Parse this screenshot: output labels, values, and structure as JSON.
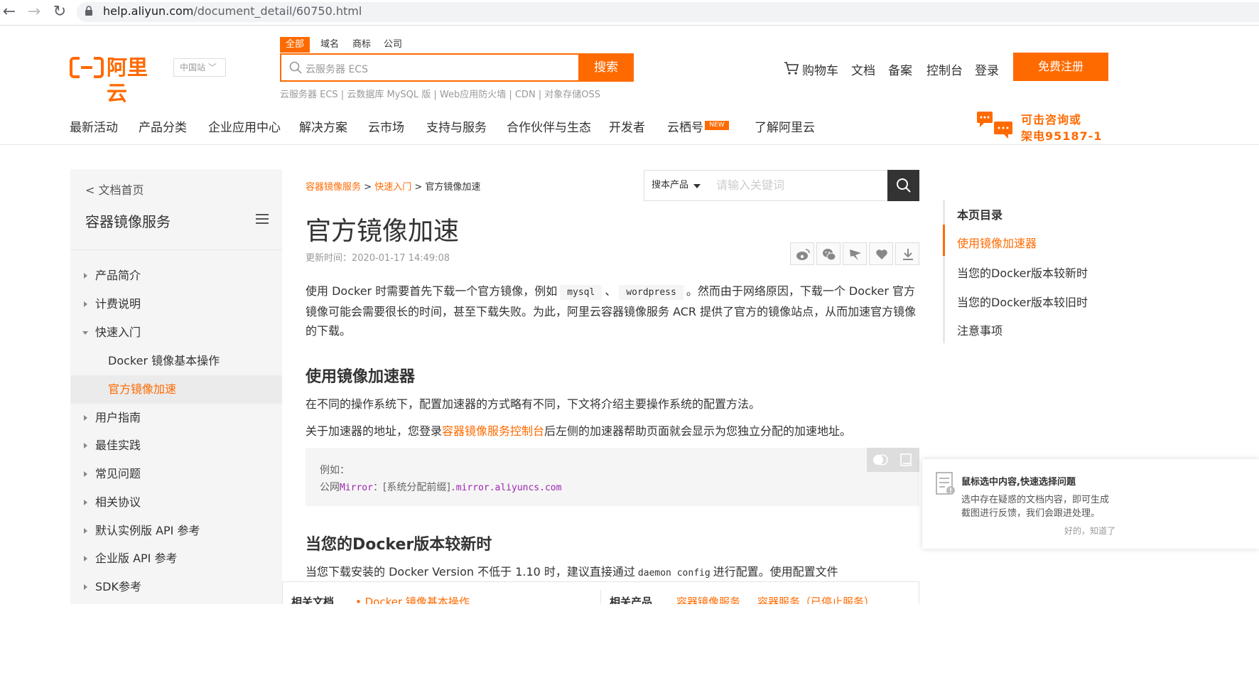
{
  "browser": {
    "url_host": "help.aliyun.com",
    "url_path": "/document_detail/60750.html"
  },
  "header": {
    "logo_text": "阿里云",
    "region": "中国站",
    "search_tabs": [
      "全部",
      "域名",
      "商标",
      "公司"
    ],
    "search_placeholder": "云服务器 ECS",
    "search_button": "搜索",
    "hot_words": "云服务器 ECS | 云数据库 MySQL 版 | Web应用防火墙 | CDN | 对象存储OSS",
    "links": [
      "购物车",
      "文档",
      "备案",
      "控制台",
      "登录"
    ],
    "register": "免费注册",
    "main_nav": [
      "最新活动",
      "产品分类",
      "企业应用中心",
      "解决方案",
      "云市场",
      "支持与服务",
      "合作伙伴与生态",
      "开发者",
      "云栖号",
      "了解阿里云"
    ],
    "new_badge": "NEW",
    "consult_line1": "可击咨询或",
    "consult_line2": "架电95187-1"
  },
  "sidebar": {
    "doc_home": "< 文档首页",
    "title": "容器镜像服务",
    "items": [
      {
        "label": "产品简介"
      },
      {
        "label": "计费说明"
      },
      {
        "label": "快速入门"
      },
      {
        "label": "Docker 镜像基本操作"
      },
      {
        "label": "官方镜像加速"
      },
      {
        "label": "用户指南"
      },
      {
        "label": "最佳实践"
      },
      {
        "label": "常见问题"
      },
      {
        "label": "相关协议"
      },
      {
        "label": "默认实例版 API 参考"
      },
      {
        "label": "企业版 API 参考"
      },
      {
        "label": "SDK参考"
      }
    ]
  },
  "main": {
    "breadcrumb": {
      "c1": "容器镜像服务",
      "sep": " > ",
      "c2": "快速入门",
      "c3": "官方镜像加速"
    },
    "product_select": "搜本产品",
    "keyword_placeholder": "请输入关键词",
    "title": "官方镜像加速",
    "update_time": "更新时间：2020-01-17 14:49:08",
    "intro_a": "使用 Docker 时需要首先下载一个官方镜像，例如",
    "code_mysql": "mysql",
    "intro_sep": "、",
    "code_wordpress": "wordpress",
    "intro_b": "。然而由于网络原因，下载一个 Docker 官方镜像可能会需要很长的时间，甚至下载失败。为此，阿里云容器镜像服务 ACR 提供了官方的镜像站点，从而加速官方镜像的下载。",
    "h2_1": "使用镜像加速器",
    "p1": "在不同的操作系统下，配置加速器的方式略有不同，下文将介绍主要操作系统的配置方法。",
    "p2_a": "关于加速器的地址，您登录",
    "p2_link": "容器镜像服务控制台",
    "p2_b": "后左侧的加速器帮助页面就会显示为您独立分配的加速地址。",
    "code_line1": "例如：",
    "code_line2_a": "公网",
    "code_line2_b": "Mirror",
    "code_line2_c": "：[系统分配前缀]",
    "code_line2_d": ".mirror.aliyuncs.com",
    "h2_2": "当您的Docker版本较新时",
    "p3_a": "当您下载安装的 Docker Version 不低于 1.10 时，建议直接通过",
    "p3_code": "daemon config",
    "p3_b": "进行配置。使用配置文件",
    "related_docs_label": "相关文档",
    "related_docs_link": "• Docker 镜像基本操作",
    "related_prod_label": "相关产品",
    "related_prod_1": "容器镜像服务",
    "related_prod_2": "容器服务（已停止服务）"
  },
  "toc": {
    "title": "本页目录",
    "items": [
      "使用镜像加速器",
      "当您的Docker版本较新时",
      "当您的Docker版本较旧时",
      "注意事项"
    ]
  },
  "feedback": {
    "title": "鼠标选中内容,快速选择问题",
    "desc1": "选中存在疑惑的文档内容，即可生成",
    "desc2": "截图进行反馈，我们会跟进处理。",
    "ok": "好的，知道了"
  },
  "colors": {
    "accent": "#ff6a00",
    "text": "#333333",
    "sidebar_bg": "#f5f5f5"
  }
}
